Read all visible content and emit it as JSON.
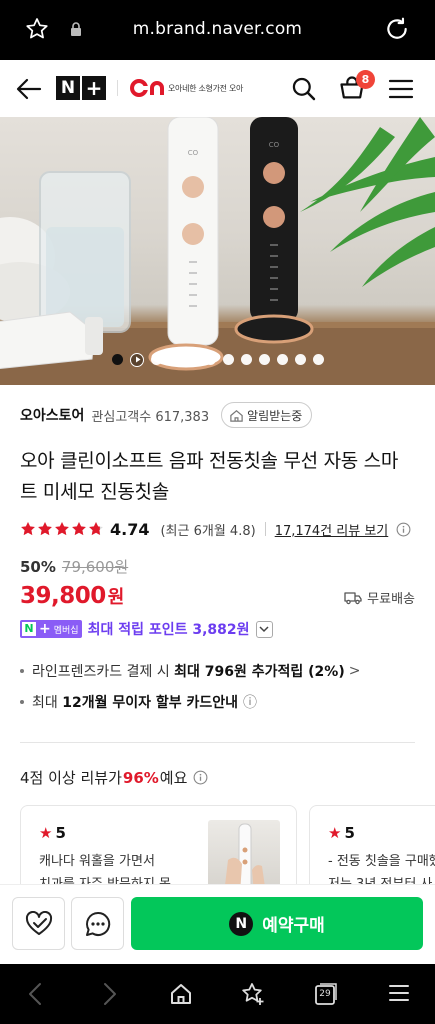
{
  "browser": {
    "url": "m.brand.naver.com"
  },
  "header": {
    "nplus_n": "N",
    "nplus_plus": "+",
    "brand_text": "오아네한 소형가전 오아",
    "cart_count": "8"
  },
  "gallery": {
    "slide_count": 12,
    "active_index": 0
  },
  "store": {
    "name": "오아스토어",
    "followers": "관심고객수 617,383",
    "alert_label": "알림받는중"
  },
  "product": {
    "title": "오아 클린이소프트 음파 전동칫솔 무선 자동 스마트 미세모 진동칫솔",
    "rating": "4.74",
    "rating_stars": 4.74,
    "recent_rating": "(최근 6개월 4.8)",
    "review_count": "17,174건 리뷰 보기",
    "discount": "50%",
    "original_price": "79,600원",
    "price": "39,800",
    "price_unit": "원",
    "shipping": "무료배송"
  },
  "membership": {
    "badge_n": "N",
    "badge_plus": "+",
    "badge_label": "멤버십",
    "points": "최대 적립 포인트 3,882원"
  },
  "benefits": [
    {
      "pre": "라인프렌즈카드 결제 시 ",
      "bold": "최대 796원 추가적립 (2%)",
      "post": "",
      "suffix": ">"
    },
    {
      "pre": "최대 ",
      "bold": "12개월 무이자 할부 카드안내",
      "post": "",
      "suffix": "ⓘ"
    }
  ],
  "review_summary": {
    "pre": "4점 이상 리뷰가 ",
    "percent": "96%",
    "post": " 예요"
  },
  "reviews": [
    {
      "score": "5",
      "line1": "캐나다 워홀을 가면서",
      "line2": "치과를 자주 방문하지 못..."
    },
    {
      "score": "5",
      "line1": "- 전동 칫솔을 구매했",
      "line2": "저는 3년 전부터 사"
    }
  ],
  "bottom": {
    "buy_label": "예약구매",
    "buy_logo": "N"
  },
  "navbar": {
    "tab_count": "29"
  },
  "colors": {
    "price_red": "#e0192b",
    "buy_green": "#03c75a",
    "membership_purple": "#6c3df0",
    "badge_red": "#f04438"
  }
}
